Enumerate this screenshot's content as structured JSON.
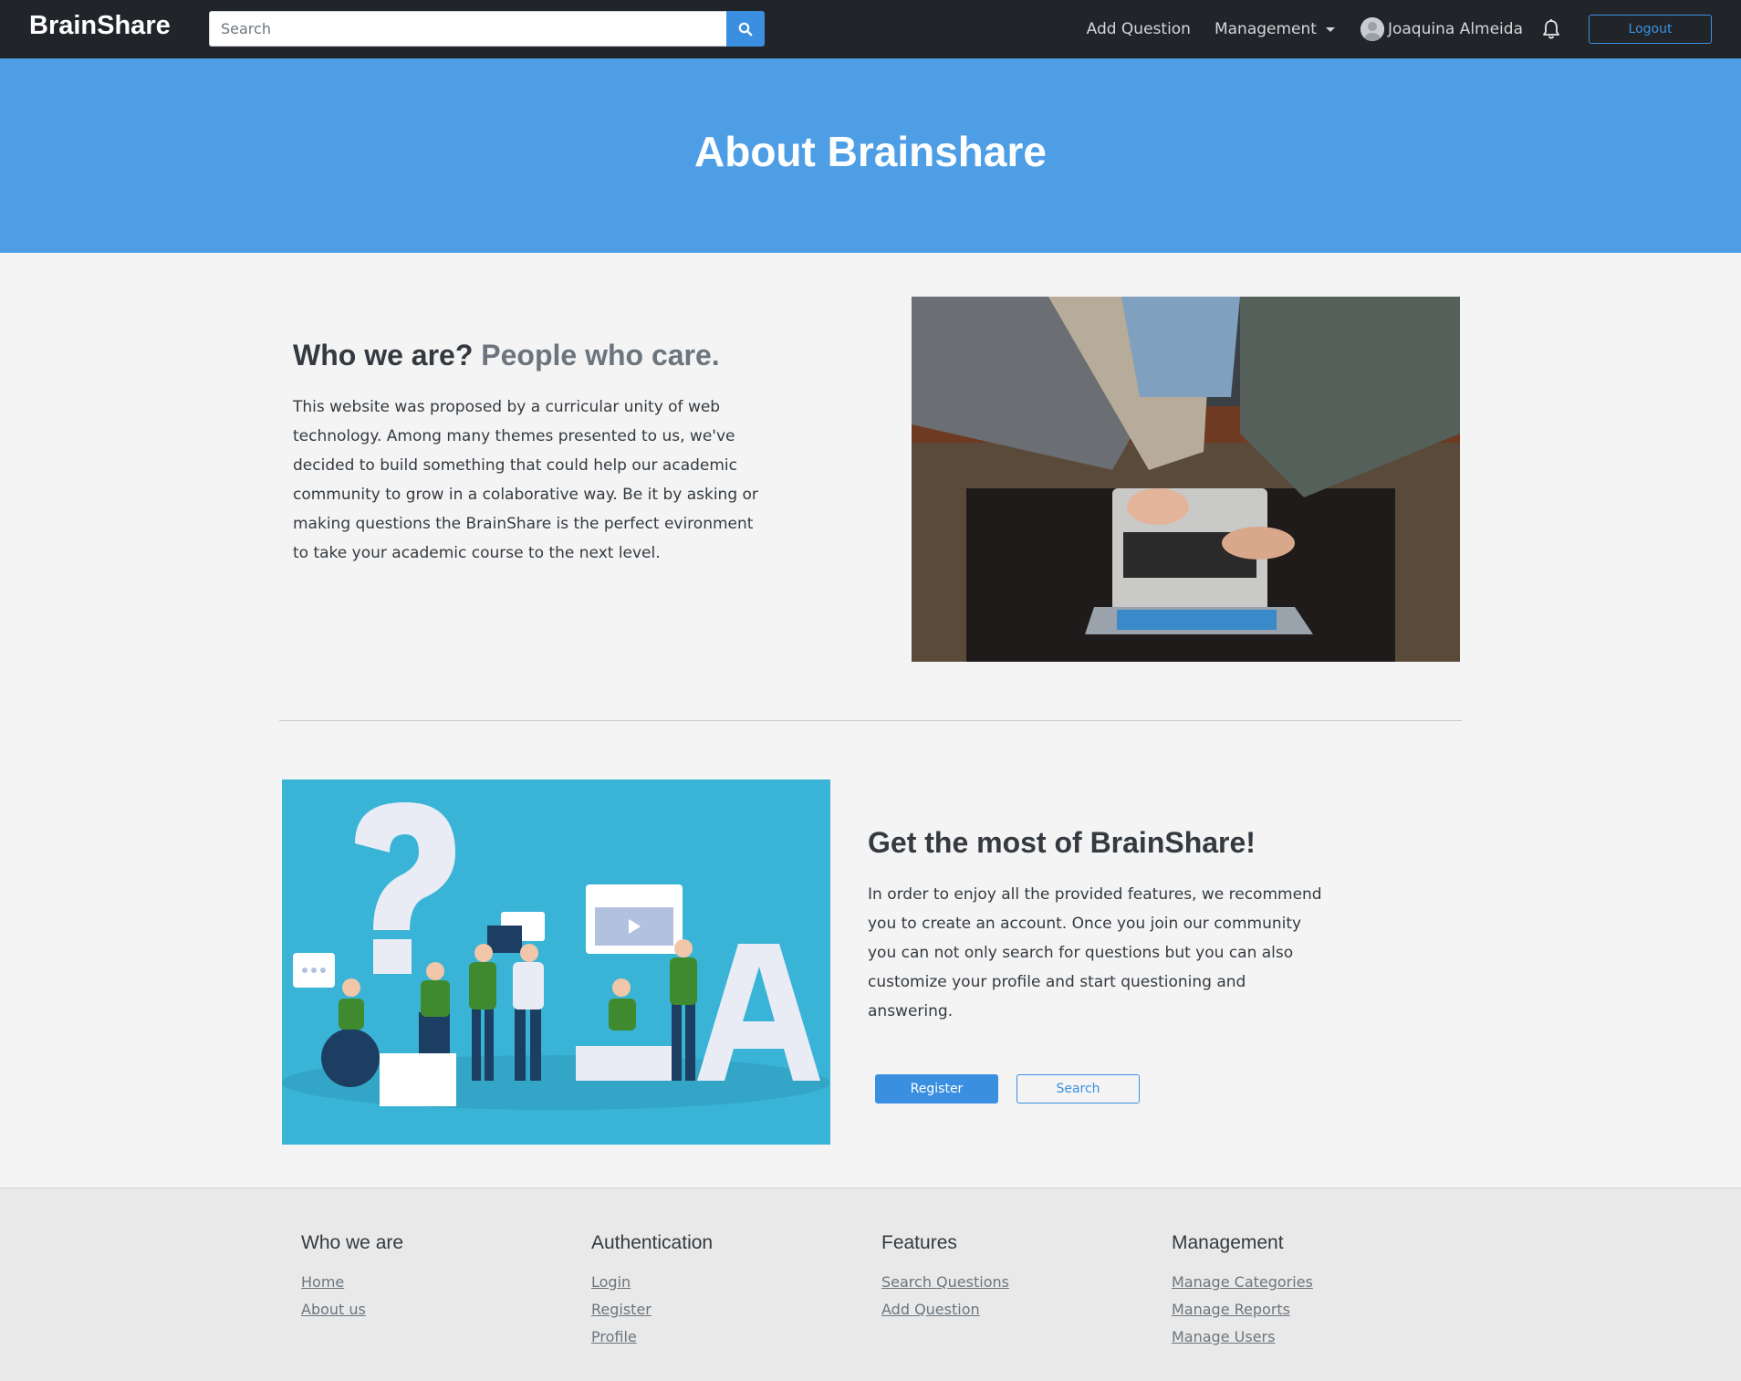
{
  "navbar": {
    "brand": "BrainShare",
    "search_placeholder": "Search",
    "add_question": "Add Question",
    "management": "Management",
    "user_name": "Joaquina Almeida",
    "logout": "Logout"
  },
  "hero": {
    "title": "About Brainshare"
  },
  "who": {
    "heading": "Who we are?",
    "heading_muted": "People who care.",
    "text": "This website was proposed by a curricular unity of web technology. Among many themes presented to us, we've decided to build something that could help our academic community to grow in a colaborative way. Be it by asking or making questions the BrainShare is the perfect evironment to take your academic course to the next level."
  },
  "most": {
    "heading": "Get the most of BrainShare!",
    "text": "In order to enjoy all the provided features, we recommend you to create an account. Once you join our community you can not only search for questions but you can also customize your profile and start questioning and answering.",
    "register": "Register",
    "search": "Search"
  },
  "footer": {
    "cols": [
      {
        "title": "Who we are",
        "links": [
          "Home",
          "About us"
        ]
      },
      {
        "title": "Authentication",
        "links": [
          "Login",
          "Register",
          "Profile"
        ]
      },
      {
        "title": "Features",
        "links": [
          "Search Questions",
          "Add Question"
        ]
      },
      {
        "title": "Management",
        "links": [
          "Manage Categories",
          "Manage Reports",
          "Manage Users"
        ]
      }
    ]
  },
  "colors": {
    "navbar_bg": "#212529",
    "hero_bg": "#4e9ee6",
    "accent": "#3b8fe0",
    "page_bg": "#f4f4f4",
    "footer_bg": "#e9e9e9",
    "illustration_bg": "#3ab4d6"
  },
  "icons": [
    "search-icon",
    "caret-down-icon",
    "user-avatar-icon",
    "bell-icon"
  ]
}
